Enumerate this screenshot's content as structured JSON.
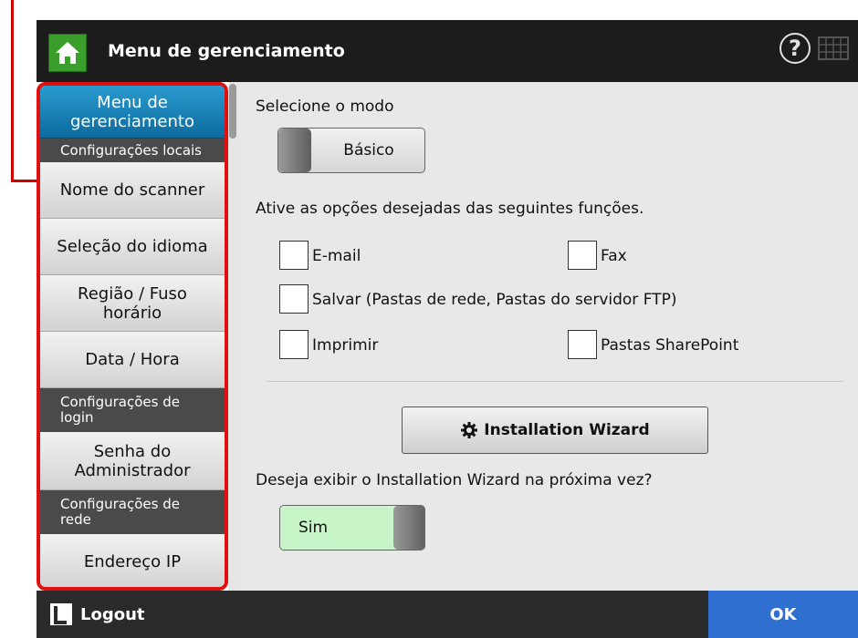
{
  "header": {
    "title": "Menu de gerenciamento",
    "help_symbol": "?"
  },
  "sidebar": {
    "active_item": "Menu de gerenciamento",
    "sections": [
      {
        "header": "Configurações locais",
        "items": [
          "Nome do scanner",
          "Seleção do idioma",
          "Região / Fuso horário",
          "Data / Hora"
        ]
      },
      {
        "header": "Configurações de login",
        "items": [
          "Senha do Administrador"
        ]
      },
      {
        "header": "Configurações de rede",
        "items": [
          "Endereço IP"
        ]
      }
    ]
  },
  "main": {
    "mode_label": "Selecione o modo",
    "mode_value": "Básico",
    "options_label": "Ative as opções desejadas das seguintes funções.",
    "options": [
      {
        "label": "E-mail",
        "checked": false
      },
      {
        "label": "Fax",
        "checked": false
      },
      {
        "label": "Salvar (Pastas de rede, Pastas do servidor FTP)",
        "checked": false
      },
      {
        "label": "Imprimir",
        "checked": false
      },
      {
        "label": "Pastas SharePoint",
        "checked": false
      }
    ],
    "wizard_button": "Installation Wizard",
    "wizard_question": "Deseja exibir o Installation Wizard na próxima vez?",
    "wizard_toggle_value": "Sim"
  },
  "footer": {
    "logout_label": "Logout",
    "ok_label": "OK"
  },
  "colors": {
    "highlight": "#e01010",
    "active_item": "#1a83bb",
    "home_button": "#3a9e2a",
    "ok_button": "#2f6fcf",
    "toggle_on": "#c8f5c8"
  },
  "icons": [
    "home-icon",
    "help-icon",
    "keyboard-icon",
    "gear-icon",
    "logout-icon"
  ]
}
